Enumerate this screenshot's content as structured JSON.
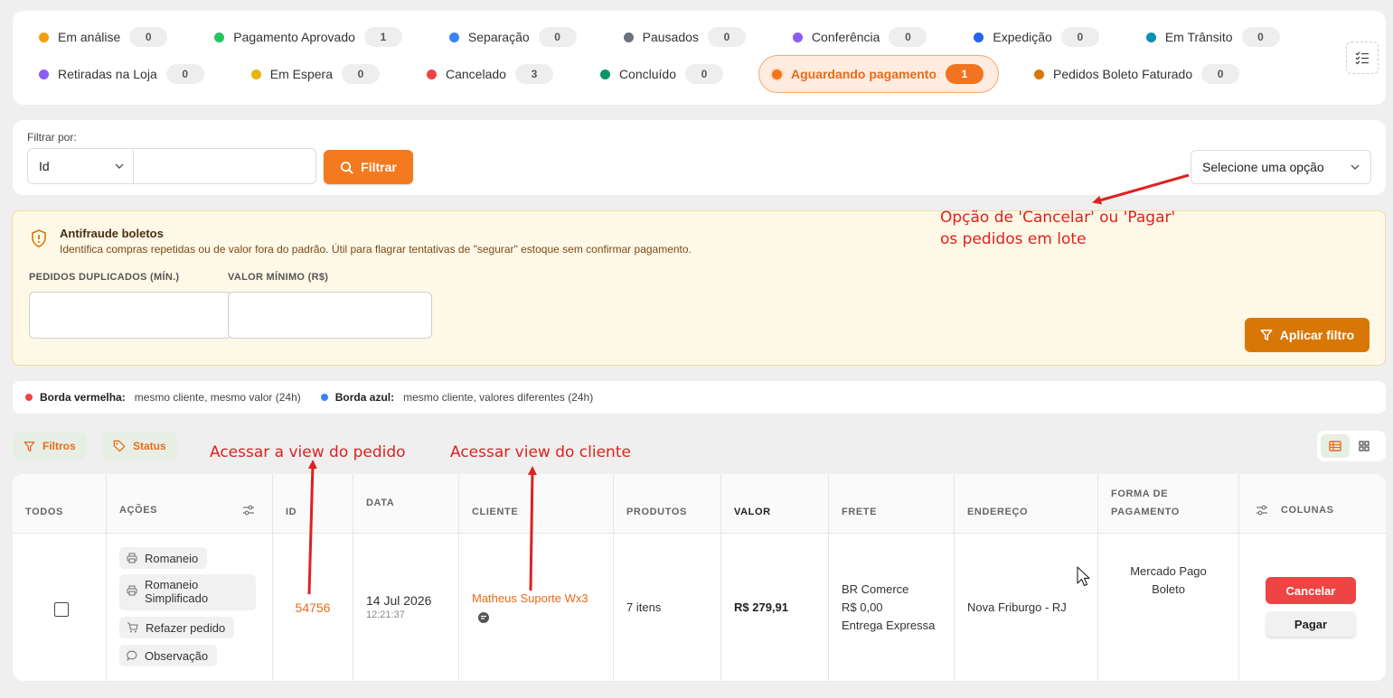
{
  "status_filters": [
    {
      "label": "Em análise",
      "count": "0",
      "color": "#f59e0b"
    },
    {
      "label": "Pagamento Aprovado",
      "count": "1",
      "color": "#22c55e"
    },
    {
      "label": "Separação",
      "count": "0",
      "color": "#3b82f6"
    },
    {
      "label": "Pausados",
      "count": "0",
      "color": "#6b7280"
    },
    {
      "label": "Conferência",
      "count": "0",
      "color": "#8b5cf6"
    },
    {
      "label": "Expedição",
      "count": "0",
      "color": "#2563eb"
    },
    {
      "label": "Em Trânsito",
      "count": "0",
      "color": "#0891b2"
    },
    {
      "label": "Retiradas na Loja",
      "count": "0",
      "color": "#8b5cf6"
    },
    {
      "label": "Em Espera",
      "count": "0",
      "color": "#eab308"
    },
    {
      "label": "Cancelado",
      "count": "3",
      "color": "#ef4444"
    },
    {
      "label": "Concluído",
      "count": "0",
      "color": "#059669"
    },
    {
      "label": "Aguardando pagamento",
      "count": "1",
      "color": "#f97316",
      "active": true
    },
    {
      "label": "Pedidos Boleto Faturado",
      "count": "0",
      "color": "#d97706"
    }
  ],
  "filter": {
    "label": "Filtrar por:",
    "field": "Id",
    "value": "",
    "button": "Filtrar",
    "bulk_placeholder": "Selecione uma opção"
  },
  "antifraud": {
    "title": "Antifraude boletos",
    "description": "Identifica compras repetidas ou de valor fora do padrão. Útil para flagrar tentativas de \"segurar\" estoque sem confirmar pagamento.",
    "dup_label": "PEDIDOS DUPLICADOS (MÍN.)",
    "min_label": "VALOR MÍNIMO (R$)",
    "apply": "Aplicar filtro"
  },
  "legend": {
    "red_label": "Borda vermelha:",
    "red_text": "mesmo cliente, mesmo valor (24h)",
    "blue_label": "Borda azul:",
    "blue_text": "mesmo cliente, valores diferentes (24h)"
  },
  "toolbar": {
    "filters": "Filtros",
    "status": "Status"
  },
  "table": {
    "headers": {
      "all": "TODOS",
      "actions": "AÇÕES",
      "id": "ID",
      "date": "DATA",
      "client": "CLIENTE",
      "products": "PRODUTOS",
      "value": "VALOR",
      "shipping": "FRETE",
      "address": "ENDEREÇO",
      "payment_1": "FORMA DE",
      "payment_2": "PAGAMENTO",
      "columns": "COLUNAS"
    },
    "row": {
      "actions": [
        "Romaneio",
        "Romaneio Simplificado",
        "Refazer pedido",
        "Observação"
      ],
      "id": "54756",
      "date": "14 Jul 2026",
      "time": "12:21:37",
      "client": "Matheus Suporte Wx3",
      "products": "7 itens",
      "value": "R$ 279,91",
      "shipping": [
        "BR Comerce",
        "R$ 0,00",
        "Entrega Expressa"
      ],
      "address": "Nova Friburgo - RJ",
      "payment": [
        "Mercado Pago",
        "Boleto"
      ],
      "cancel": "Cancelar",
      "pay": "Pagar"
    }
  },
  "annotations": {
    "bulk_1": "Opção de 'Cancelar' ou 'Pagar'",
    "bulk_2": "os pedidos em lote",
    "order_view": "Acessar a view do pedido",
    "client_view": "Acessar view do cliente"
  }
}
